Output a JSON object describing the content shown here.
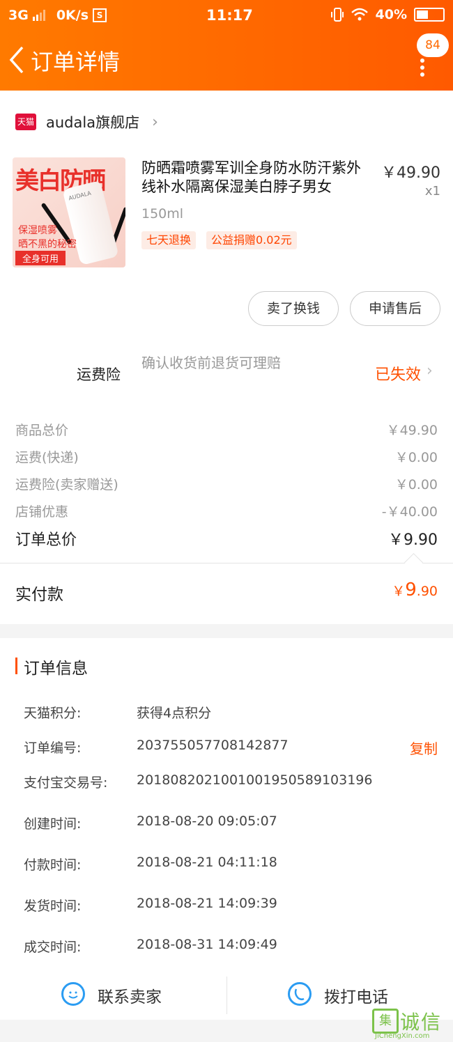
{
  "status_bar": {
    "network": "3G",
    "speed": "0K/s",
    "s_icon": "S",
    "time": "11:17",
    "battery": "40%"
  },
  "nav": {
    "title": "订单详情",
    "badge": "84"
  },
  "shop": {
    "logo": "天猫",
    "name": "audala旗舰店"
  },
  "product": {
    "title": "防晒霜喷雾军训全身防水防汗紫外线补水隔离保湿美白脖子男女",
    "price": "￥49.90",
    "quantity": "x1",
    "spec": "150ml",
    "tags": [
      "七天退换",
      "公益捐赠0.02元"
    ],
    "image": {
      "headline": "美白防晒",
      "brand": "AUDALA",
      "line1": "保湿喷雾",
      "line2": "晒不黑的秘密",
      "badge": "全身可用"
    }
  },
  "actions": {
    "sell_label": "卖了换钱",
    "after_sale_label": "申请售后"
  },
  "insurance": {
    "label": "运费险",
    "description": "确认收货前退货可理赔",
    "status": "已失效"
  },
  "price_lines": [
    {
      "label": "商品总价",
      "value": "￥49.90"
    },
    {
      "label": "运费(快递)",
      "value": "￥0.00"
    },
    {
      "label": "运费险(卖家赠送)",
      "value": "￥0.00"
    },
    {
      "label": "店铺优惠",
      "value": "-￥40.00"
    }
  ],
  "order_total": {
    "label": "订单总价",
    "value": "￥9.90"
  },
  "paid": {
    "label": "实付款",
    "currency": "￥",
    "int": "9",
    "dec": ".90"
  },
  "order_info": {
    "heading": "订单信息",
    "copy_label": "复制",
    "rows": [
      {
        "label": "天猫积分:",
        "value": "获得4点积分"
      },
      {
        "label": "订单编号:",
        "value": "203755057708142877"
      },
      {
        "label": "支付宝交易号:",
        "value": "2018082021001001950589103196"
      },
      {
        "label": "创建时间:",
        "value": "2018-08-20 09:05:07"
      },
      {
        "label": "付款时间:",
        "value": "2018-08-21 04:11:18"
      },
      {
        "label": "发货时间:",
        "value": "2018-08-21 14:09:39"
      },
      {
        "label": "成交时间:",
        "value": "2018-08-31 14:09:49"
      }
    ]
  },
  "contact": {
    "seller_label": "联系卖家",
    "call_label": "拨打电话"
  },
  "watermark": {
    "box": "集",
    "text": "诚信",
    "url": "JiChengXin.com"
  },
  "colors": {
    "header_start": "#ff7a00",
    "header_end": "#ff5a00",
    "accent": "#ff5000",
    "icon_blue": "#2b9cf2"
  }
}
